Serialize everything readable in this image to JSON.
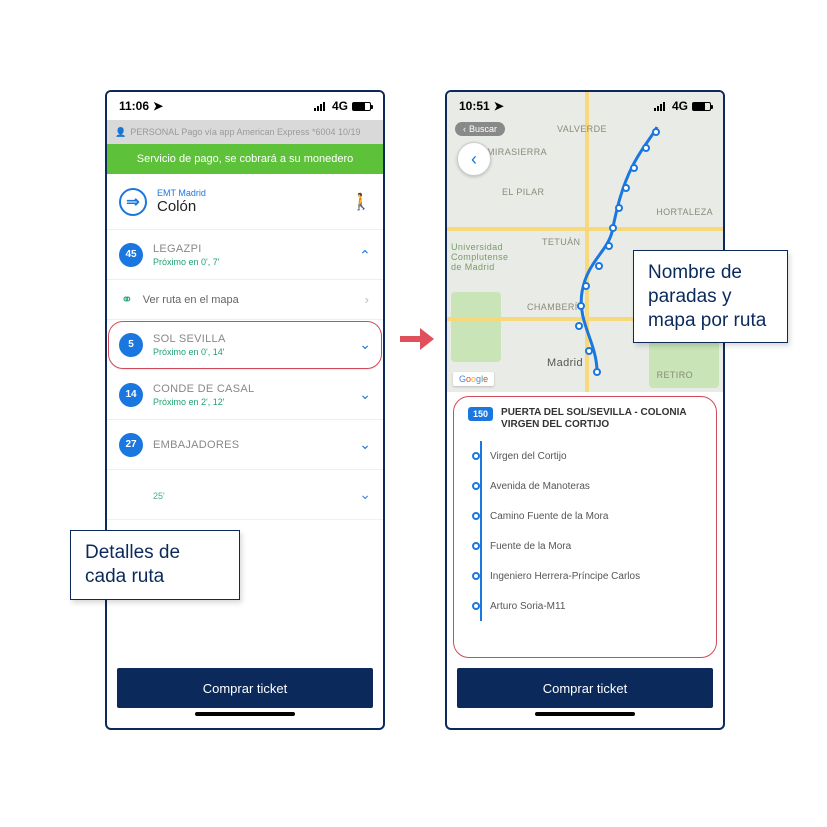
{
  "left": {
    "status": {
      "time": "11:06",
      "net": "4G"
    },
    "subheader": "PERSONAL  Pago vía app  American Express  *6004  10/19",
    "banner": "Servicio de pago, se cobrará a su monedero",
    "provider": "EMT Madrid",
    "stop_name": "Colón",
    "map_link": "Ver ruta en el mapa",
    "routes": [
      {
        "num": "45",
        "name": "LEGAZPI",
        "sub": "Próximo en 0', 7'",
        "open": true
      },
      {
        "num": "5",
        "name": "SOL SEVILLA",
        "sub": "Próximo en 0', 14'",
        "open": false,
        "hl": true
      },
      {
        "num": "14",
        "name": "CONDE DE CASAL",
        "sub": "Próximo en 2', 12'",
        "open": false
      },
      {
        "num": "27",
        "name": "EMBAJADORES",
        "sub": "",
        "open": false
      },
      {
        "num": "",
        "name": "",
        "sub": "25'",
        "open": false
      }
    ],
    "buy": "Comprar ticket"
  },
  "right": {
    "status": {
      "time": "10:51",
      "net": "4G"
    },
    "buscar": "Buscar",
    "map_labels": {
      "valverde": "VALVERDE",
      "mirasierra": "MIRASIERRA",
      "pilar": "EL PILAR",
      "hortaleza": "HORTALEZA",
      "tetuan": "TETUÁN",
      "uni": "Universidad Complutense de Madrid",
      "chamberi": "CHAMBERÍ",
      "madrid": "Madrid",
      "retiro": "RETIRO"
    },
    "line": "150",
    "line_title": "PUERTA DEL SOL/SEVILLA - COLONIA VIRGEN DEL CORTIJO",
    "stops": [
      "Virgen del Cortijo",
      "Avenida de Manoteras",
      "Camino Fuente de la Mora",
      "Fuente de la Mora",
      "Ingeniero Herrera-Príncipe Carlos",
      "Arturo Soria-M11"
    ],
    "buy": "Comprar ticket",
    "google": "Google"
  },
  "callouts": {
    "left": "Detalles de cada ruta",
    "right": "Nombre de paradas y mapa por ruta"
  }
}
